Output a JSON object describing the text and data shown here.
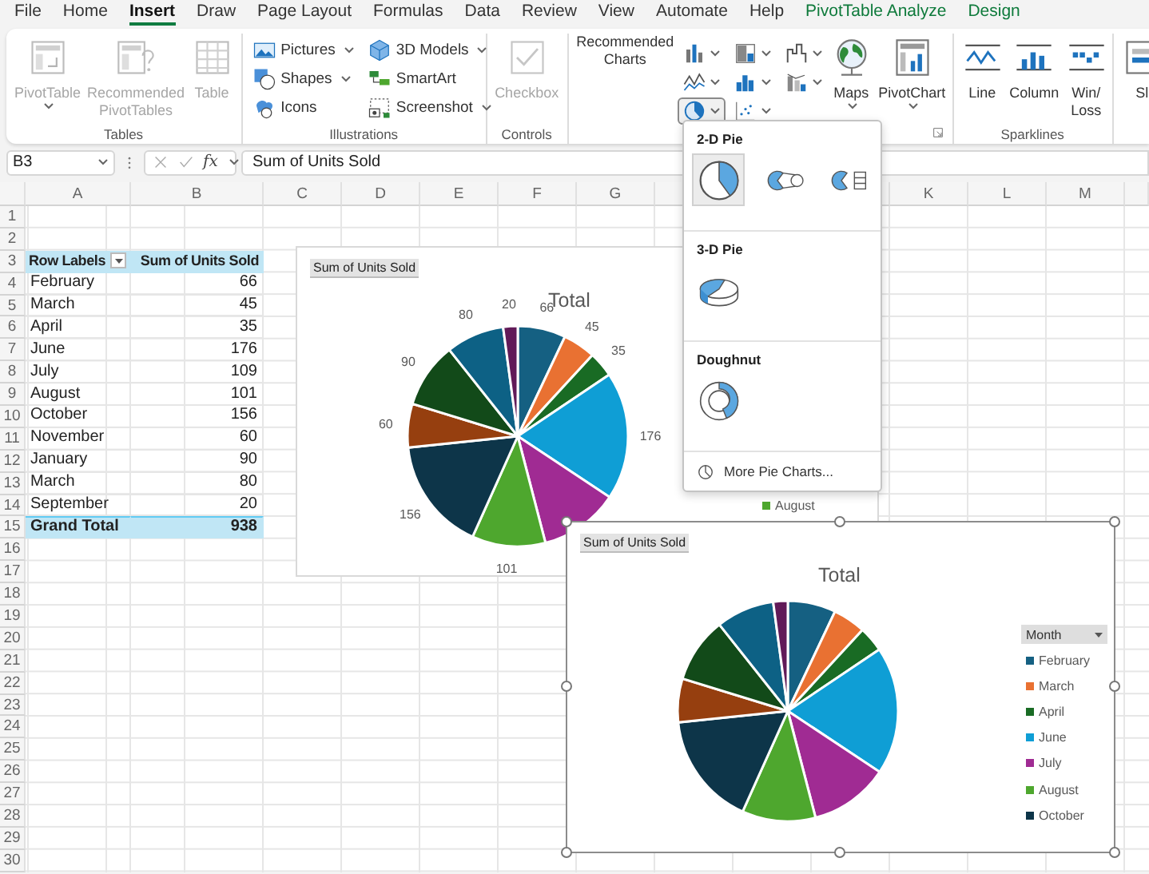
{
  "menu_tabs": [
    {
      "label": "File",
      "selected": false,
      "kind": "standard"
    },
    {
      "label": "Home",
      "selected": false,
      "kind": "standard"
    },
    {
      "label": "Insert",
      "selected": true,
      "kind": "standard"
    },
    {
      "label": "Draw",
      "selected": false,
      "kind": "standard"
    },
    {
      "label": "Page Layout",
      "selected": false,
      "kind": "standard"
    },
    {
      "label": "Formulas",
      "selected": false,
      "kind": "standard"
    },
    {
      "label": "Data",
      "selected": false,
      "kind": "standard"
    },
    {
      "label": "Review",
      "selected": false,
      "kind": "standard"
    },
    {
      "label": "View",
      "selected": false,
      "kind": "standard"
    },
    {
      "label": "Automate",
      "selected": false,
      "kind": "standard"
    },
    {
      "label": "Help",
      "selected": false,
      "kind": "standard"
    },
    {
      "label": "PivotTable Analyze",
      "selected": false,
      "kind": "contextual"
    },
    {
      "label": "Design",
      "selected": false,
      "kind": "contextual"
    }
  ],
  "ribbon": {
    "groups": [
      {
        "label": "Tables",
        "kind": "large",
        "controls": [
          {
            "label": "PivotTable",
            "kind": "pivottable",
            "disabled": true,
            "menu": true
          },
          {
            "label": "Recommended\nPivotTables",
            "kind": "recpivot",
            "disabled": true,
            "menu": false
          },
          {
            "label": "Table",
            "kind": "table",
            "disabled": true,
            "menu": false
          }
        ]
      },
      {
        "label": "Illustrations",
        "kind": "small",
        "controls": [
          {
            "label": "Pictures",
            "kind": "pictures",
            "disabled": false,
            "menu": true
          },
          {
            "label": "Shapes",
            "kind": "shapes",
            "disabled": false,
            "menu": true
          },
          {
            "label": "Icons",
            "kind": "icons",
            "disabled": false,
            "menu": false
          },
          {
            "label": "3D Models",
            "kind": "models",
            "disabled": false,
            "menu": true
          },
          {
            "label": "SmartArt",
            "kind": "smartart",
            "disabled": false,
            "menu": false
          },
          {
            "label": "Screenshot",
            "kind": "screenshot",
            "disabled": false,
            "menu": true
          }
        ]
      },
      {
        "label": "Controls",
        "kind": "large",
        "controls": [
          {
            "label": "Checkbox",
            "kind": "checkbox",
            "disabled": true,
            "menu": false
          }
        ]
      },
      {
        "kind": "large",
        "dialog_launcher": true,
        "controls": [
          {
            "label": "Recommended\nCharts",
            "kind": "reccharts",
            "disabled": false,
            "menu": false
          },
          {
            "label": "Maps",
            "kind": "maps",
            "disabled": false,
            "menu": true
          },
          {
            "label": "PivotChart",
            "kind": "pivotchart",
            "disabled": false,
            "menu": true
          }
        ],
        "gallery": [
          {
            "kind": "column",
            "selected": false
          },
          {
            "kind": "treemap",
            "selected": false
          },
          {
            "kind": "waterfall",
            "selected": false
          },
          {
            "kind": "line",
            "selected": false
          },
          {
            "kind": "statistic",
            "selected": false
          },
          {
            "kind": "combo",
            "selected": false
          },
          {
            "kind": "pie",
            "selected": true
          },
          {
            "kind": "scatter",
            "selected": false
          }
        ]
      },
      {
        "label": "Sparklines",
        "kind": "large",
        "controls": [
          {
            "label": "Line",
            "kind": "sparkline",
            "disabled": false,
            "menu": false
          },
          {
            "label": "Column",
            "kind": "sparkcolumn",
            "disabled": false,
            "menu": false
          },
          {
            "label": "Win/\nLoss",
            "kind": "winloss",
            "disabled": false,
            "menu": false
          }
        ]
      },
      {
        "kind": "large",
        "controls": [
          {
            "label": "Sl",
            "kind": "slicer",
            "disabled": false,
            "menu": false
          }
        ]
      }
    ]
  },
  "formula_bar": {
    "name_box": "B3",
    "function_button": "fx",
    "value": "Sum of Units Sold"
  },
  "sheet": {
    "columns_left": [
      "A",
      "B",
      "C",
      "D",
      "E",
      "F",
      "G"
    ],
    "columns_right": [
      "K",
      "L",
      "M"
    ],
    "rows": [
      {
        "number": "1"
      },
      {
        "number": "2"
      },
      {
        "number": "3",
        "kind": "header",
        "cells": [
          "Row Labels",
          "Sum of Units Sold"
        ]
      },
      {
        "number": "4",
        "kind": "item",
        "cells": [
          "February",
          "66"
        ]
      },
      {
        "number": "5",
        "kind": "item",
        "cells": [
          "March",
          "45"
        ]
      },
      {
        "number": "6",
        "kind": "item",
        "cells": [
          "April",
          "35"
        ]
      },
      {
        "number": "7",
        "kind": "item",
        "cells": [
          "June",
          "176"
        ]
      },
      {
        "number": "8",
        "kind": "item",
        "cells": [
          "July",
          "109"
        ]
      },
      {
        "number": "9",
        "kind": "item",
        "cells": [
          "August",
          "101"
        ]
      },
      {
        "number": "10",
        "kind": "item",
        "cells": [
          "October",
          "156"
        ]
      },
      {
        "number": "11",
        "kind": "item",
        "cells": [
          "November",
          "60"
        ]
      },
      {
        "number": "12",
        "kind": "item",
        "cells": [
          "January",
          "90"
        ]
      },
      {
        "number": "13",
        "kind": "item",
        "cells": [
          "March",
          "80"
        ]
      },
      {
        "number": "14",
        "kind": "item",
        "cells": [
          "September",
          "20"
        ]
      },
      {
        "number": "15",
        "kind": "total",
        "cells": [
          "Grand Total",
          "938"
        ]
      },
      {
        "number": "16"
      },
      {
        "number": "17"
      },
      {
        "number": "18"
      },
      {
        "number": "19"
      },
      {
        "number": "20"
      },
      {
        "number": "21"
      },
      {
        "number": "22"
      },
      {
        "number": "23"
      },
      {
        "number": "24"
      },
      {
        "number": "25"
      },
      {
        "number": "26"
      },
      {
        "number": "27"
      },
      {
        "number": "28"
      },
      {
        "number": "29"
      },
      {
        "number": "30"
      }
    ]
  },
  "charts": [
    {
      "field_button": "Sum of Units Sold",
      "selected": false,
      "chart_data": {
        "type": "pie",
        "title": "Total",
        "series": [
          {
            "values": [
              7.04,
              4.8,
              3.73,
              18.76,
              11.62,
              10.77,
              16.63,
              6.4,
              9.59,
              8.53,
              2.13
            ],
            "colors": [
              "#156082",
              "#e97132",
              "#196b24",
              "#0f9ed5",
              "#a02b93",
              "#4ea72e",
              "#0d3549",
              "#963f0f",
              "#124a19",
              "#0d6185",
              "#611a58"
            ]
          }
        ],
        "value_labels": [
          "66",
          "45",
          "35",
          "176",
          null,
          "101",
          "156",
          "60",
          "90",
          "80",
          "20"
        ]
      },
      "legend": {
        "items": [
          {
            "name": "August",
            "color": "#4ea72e"
          }
        ]
      }
    },
    {
      "field_button": "Sum of Units Sold",
      "selected": true,
      "chart_data": {
        "type": "pie",
        "title": "Total",
        "series": [
          {
            "values": [
              7.04,
              4.8,
              3.73,
              18.76,
              11.62,
              10.77,
              16.63,
              6.4,
              9.59,
              8.53,
              2.13
            ],
            "colors": [
              "#156082",
              "#e97132",
              "#196b24",
              "#0f9ed5",
              "#a02b93",
              "#4ea72e",
              "#0d3549",
              "#963f0f",
              "#124a19",
              "#0d6185",
              "#611a58"
            ]
          }
        ]
      },
      "legend": {
        "title": "Month",
        "items": [
          {
            "name": "February",
            "color": "#156082"
          },
          {
            "name": "March",
            "color": "#e97132"
          },
          {
            "name": "April",
            "color": "#196b24"
          },
          {
            "name": "June",
            "color": "#0f9ed5"
          },
          {
            "name": "July",
            "color": "#a02b93"
          },
          {
            "name": "August",
            "color": "#4ea72e"
          },
          {
            "name": "October",
            "color": "#0d3549"
          }
        ]
      }
    }
  ],
  "pie_menu": {
    "sections": [
      {
        "heading": "2-D Pie",
        "options": [
          {
            "kind": "pie2d",
            "selected": true
          },
          {
            "kind": "pieofpie",
            "selected": false
          },
          {
            "kind": "barofpie",
            "selected": false
          }
        ]
      },
      {
        "heading": "3-D Pie",
        "options": [
          {
            "kind": "pie3d",
            "selected": false
          }
        ]
      },
      {
        "heading": "Doughnut",
        "options": [
          {
            "kind": "doughnut",
            "selected": false
          }
        ]
      }
    ],
    "more_link": "More Pie Charts..."
  }
}
